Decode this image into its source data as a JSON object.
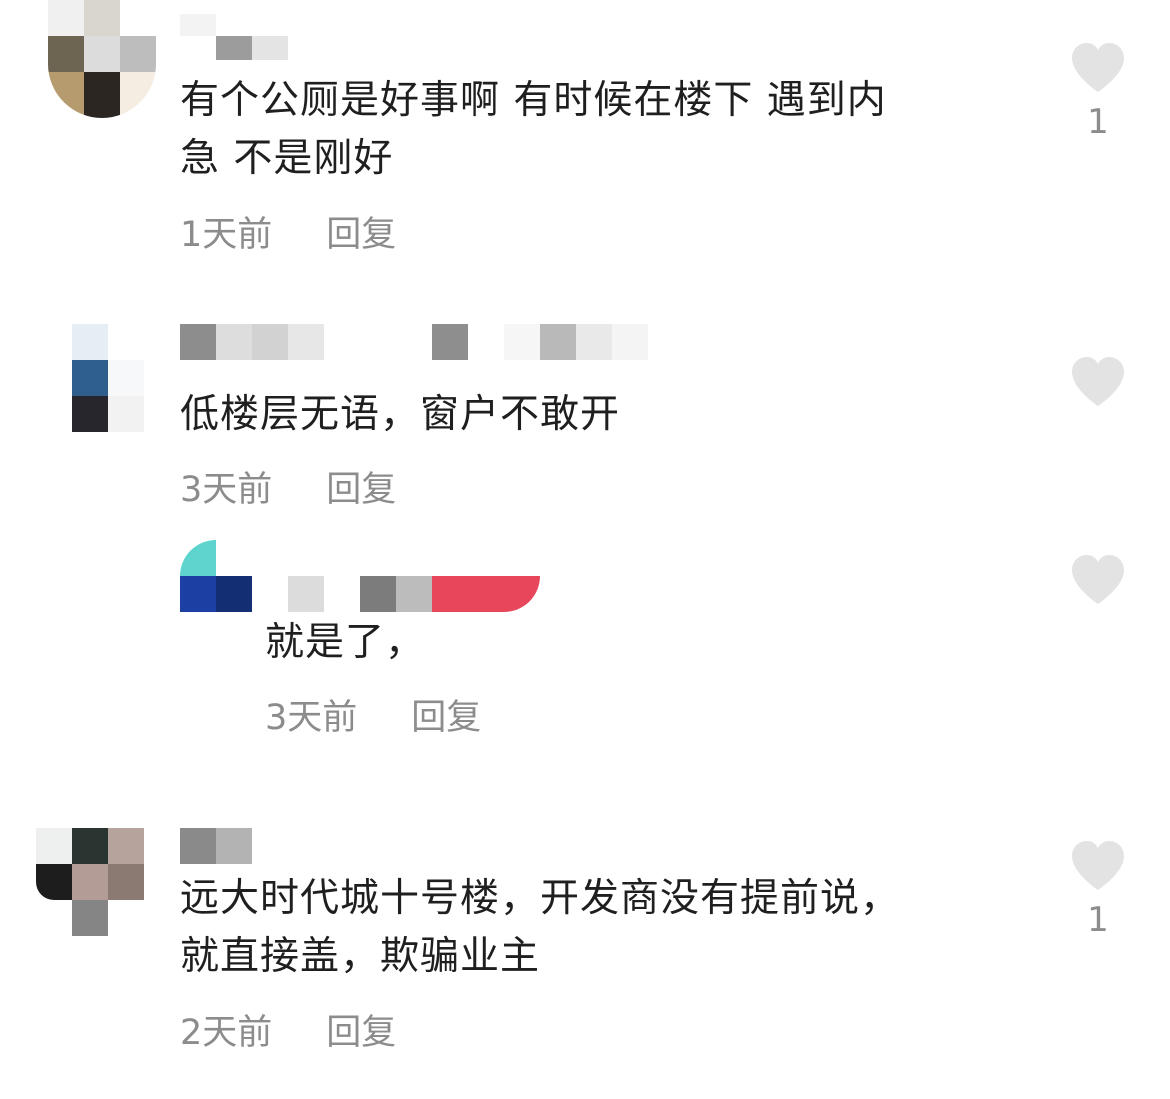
{
  "comments": [
    {
      "text": "有个公厕是好事啊 有时候在楼下 遇到内\n急 不是刚好",
      "time": "1天前",
      "reply": "回复",
      "likes": "1"
    },
    {
      "text": "低楼层无语，窗户不敢开",
      "time": "3天前",
      "reply": "回复",
      "likes": "",
      "replies": [
        {
          "text": "就是了，",
          "time": "3天前",
          "reply": "回复",
          "likes": ""
        }
      ]
    },
    {
      "text": "远大时代城十号楼，开发商没有提前说，\n就直接盖，欺骗业主",
      "time": "2天前",
      "reply": "回复",
      "likes": "1"
    }
  ],
  "colors": {
    "text": "#1f1f1f",
    "meta": "#8c8c8c",
    "heart": "#e3e3e3",
    "accent_red": "#e8465a"
  },
  "icons": [
    "heart-icon"
  ]
}
